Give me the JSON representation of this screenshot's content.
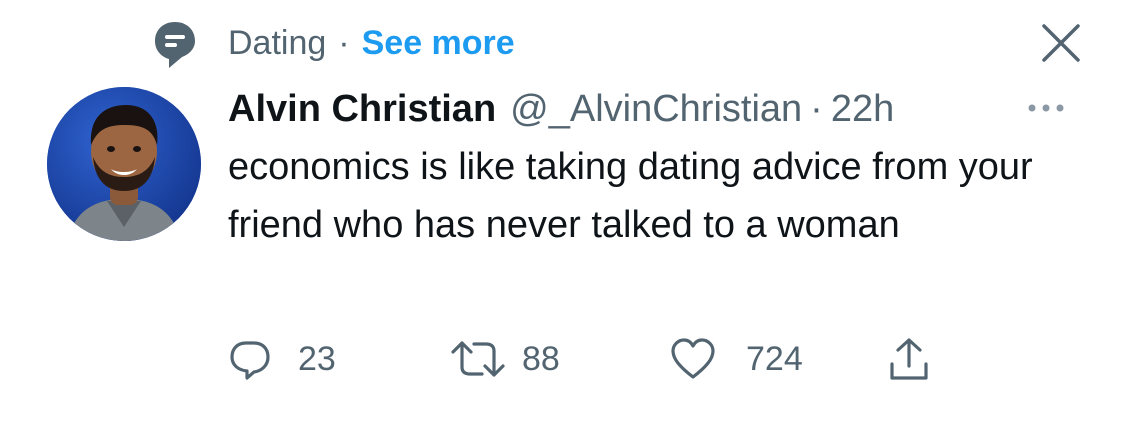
{
  "context": {
    "topic": "Dating",
    "separator": "·",
    "see_more": "See more",
    "topic_icon": "topic-pin-icon",
    "close_icon": "close-icon"
  },
  "tweet": {
    "author": {
      "name": "Alvin Christian",
      "handle": "@_AlvinChristian",
      "avatar": "avatar-photo"
    },
    "time_separator": "·",
    "timestamp": "22h",
    "more_icon": "more-options-icon",
    "text": "economics is like taking dating advice from your friend who has never talked to a woman"
  },
  "actions": {
    "reply": {
      "icon": "reply-icon",
      "count": "23"
    },
    "retweet": {
      "icon": "retweet-icon",
      "count": "88"
    },
    "like": {
      "icon": "heart-icon",
      "count": "724"
    },
    "share": {
      "icon": "share-icon"
    }
  },
  "colors": {
    "text": "#0f1419",
    "secondary": "#536471",
    "link": "#1d9bf0",
    "background": "#ffffff"
  }
}
